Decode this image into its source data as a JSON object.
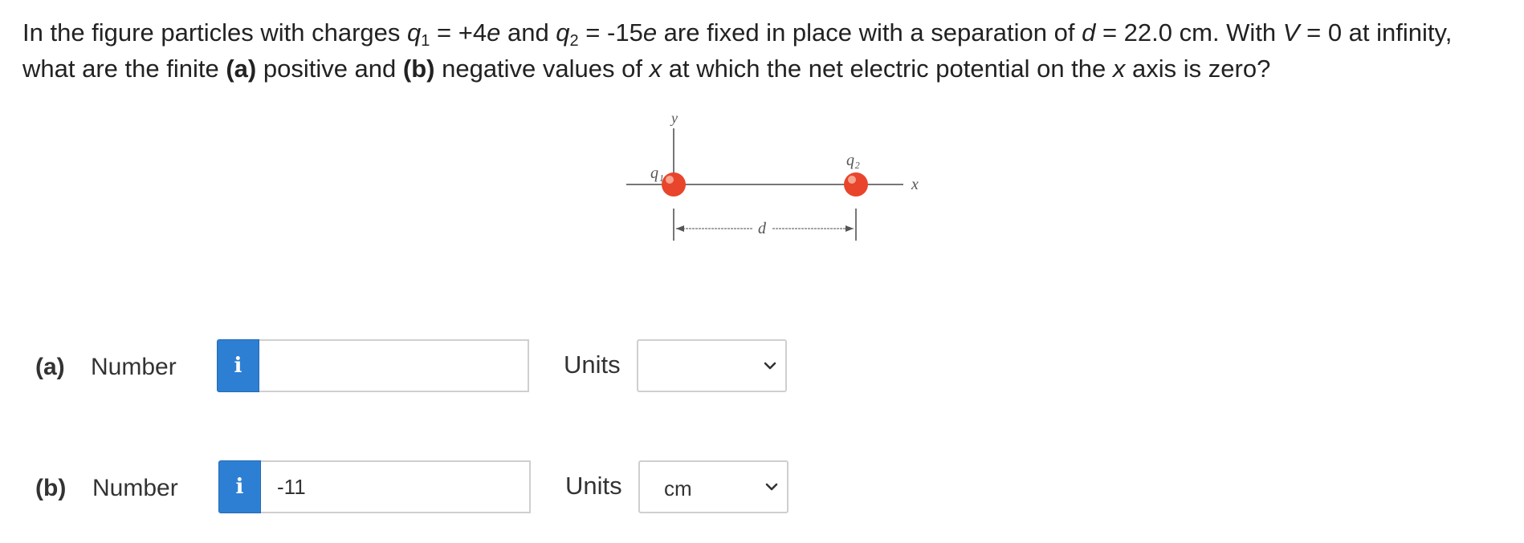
{
  "question": {
    "intro": "In the figure particles with charges ",
    "q1_symbol": "q",
    "q1_sub": "1",
    "q1_value": " = +4",
    "e1": "e",
    "and": " and ",
    "q2_symbol": "q",
    "q2_sub": "2",
    "q2_value": " = -15",
    "e2": "e",
    "mid": " are fixed in place with a separation of ",
    "d_symbol": "d",
    "d_value": " = 22.0 cm. With ",
    "v_symbol": "V",
    "v_value": " = 0 at infinity, what are the finite ",
    "part_a": "(a)",
    "positive": " positive and ",
    "part_b": "(b)",
    "negative": " negative values of ",
    "x_symbol": "x",
    "at_which": " at which the net electric potential on the ",
    "x_symbol2": "x",
    "end": " axis is zero?"
  },
  "figure": {
    "y_label": "y",
    "x_label": "x",
    "q1_label": "q₁",
    "q2_label": "q₂",
    "d_label": "d",
    "charge_color": "#e8452c",
    "line_color": "#666666"
  },
  "answers": {
    "a": {
      "part_label": "(a)",
      "number_label": "Number",
      "info_icon": "i",
      "value": "",
      "units_label": "Units",
      "units_value": ""
    },
    "b": {
      "part_label": "(b)",
      "number_label": "Number",
      "info_icon": "i",
      "value": "-11",
      "units_label": "Units",
      "units_value": "cm"
    }
  }
}
